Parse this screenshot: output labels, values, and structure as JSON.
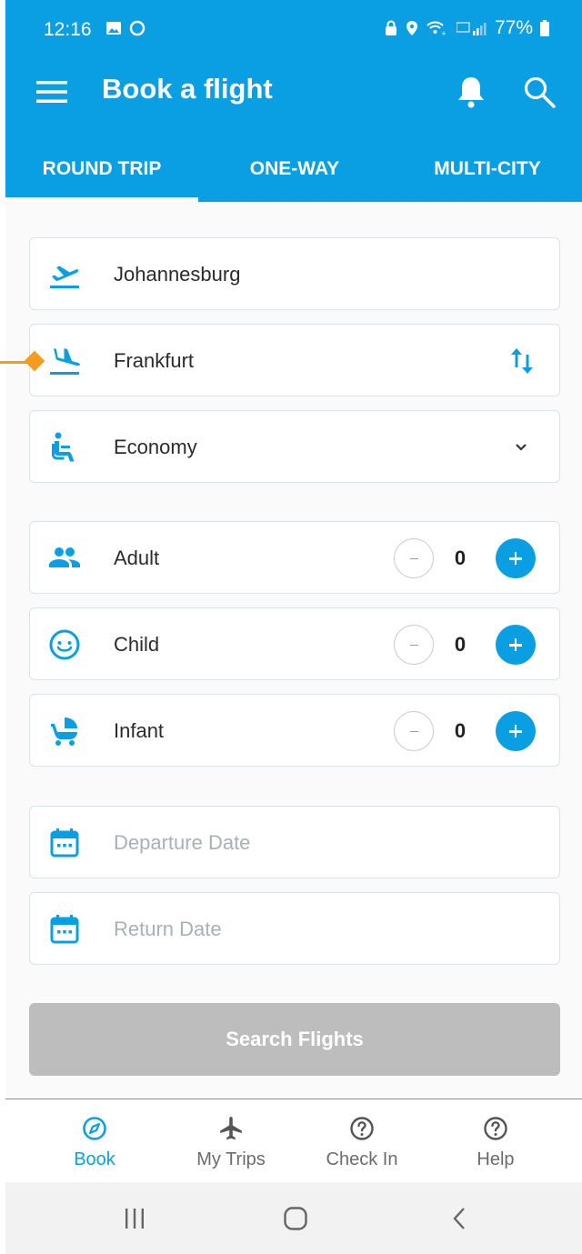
{
  "status_bar": {
    "time": "12:16",
    "battery": "77%"
  },
  "app_bar": {
    "title": "Book a flight"
  },
  "tabs": [
    {
      "label": "ROUND TRIP",
      "active": true
    },
    {
      "label": "ONE-WAY",
      "active": false
    },
    {
      "label": "MULTI-CITY",
      "active": false
    }
  ],
  "form": {
    "origin": "Johannesburg",
    "destination": "Frankfurt",
    "cabin_class": "Economy",
    "passengers": [
      {
        "label": "Adult",
        "count": "0"
      },
      {
        "label": "Child",
        "count": "0"
      },
      {
        "label": "Infant",
        "count": "0"
      }
    ],
    "departure_placeholder": "Departure Date",
    "return_placeholder": "Return Date",
    "search_label": "Search Flights"
  },
  "bottom_nav": [
    {
      "label": "Book",
      "icon": "compass-icon",
      "active": true
    },
    {
      "label": "My Trips",
      "icon": "airplane-icon",
      "active": false
    },
    {
      "label": "Check In",
      "icon": "help-circle-icon",
      "active": false
    },
    {
      "label": "Help",
      "icon": "help-circle-icon",
      "active": false
    }
  ],
  "colors": {
    "primary": "#0a9ee2",
    "disabled_button": "#bdbdbd",
    "annotation": "#f39c1d"
  }
}
